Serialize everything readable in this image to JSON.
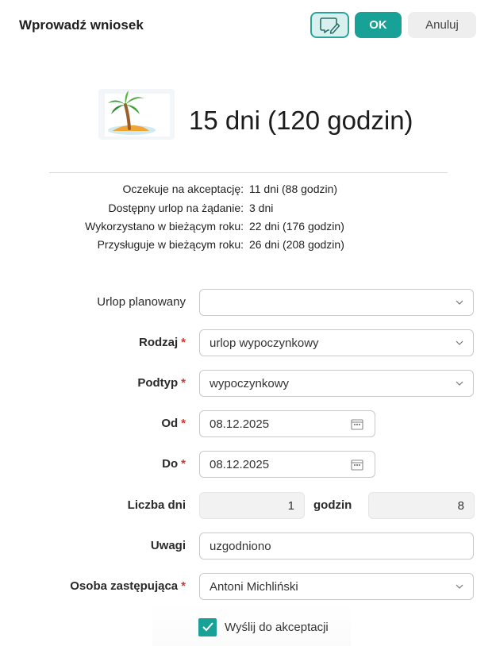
{
  "header": {
    "title": "Wprowadź wniosek",
    "ok_label": "OK",
    "cancel_label": "Anuluj",
    "note_icon": "note-pen-icon"
  },
  "summary": {
    "icon": "palm-tree-icon",
    "total": "15 dni (120 godzin)"
  },
  "stats": [
    {
      "label": "Oczekuje na akceptację:",
      "value": "11 dni (88 godzin)"
    },
    {
      "label": "Dostępny urlop na żądanie:",
      "value": "3 dni"
    },
    {
      "label": "Wykorzystano w bieżącym roku:",
      "value": "22 dni (176 godzin)"
    },
    {
      "label": "Przysługuje w bieżącym roku:",
      "value": "26 dni (208 godzin)"
    }
  ],
  "form": {
    "planned": {
      "label": "Urlop planowany",
      "value": ""
    },
    "type": {
      "label": "Rodzaj",
      "value": "urlop wypoczynkowy"
    },
    "subtype": {
      "label": "Podtyp",
      "value": "wypoczynkowy"
    },
    "from": {
      "label": "Od",
      "value": "08.12.2025"
    },
    "to": {
      "label": "Do",
      "value": "08.12.2025"
    },
    "days": {
      "label": "Liczba dni",
      "value": "1"
    },
    "hours": {
      "label": "godzin",
      "value": "8"
    },
    "notes": {
      "label": "Uwagi",
      "value": "uzgodniono"
    },
    "substitute": {
      "label": "Osoba zastępująca",
      "value": "Antoni Michliński"
    },
    "required_mark": "*"
  },
  "send_for_approval": {
    "label": "Wyślij do akceptacji",
    "checked": true
  },
  "colors": {
    "accent": "#17a197",
    "required": "#d7332f"
  }
}
